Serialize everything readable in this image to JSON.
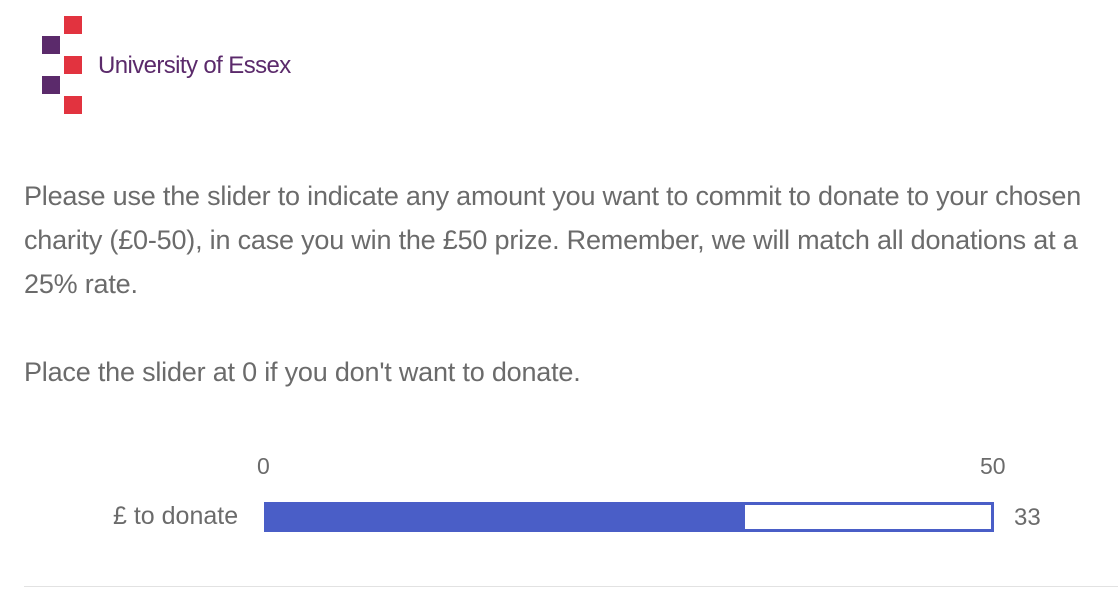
{
  "logo": {
    "text": "University of Essex",
    "colors": {
      "purple": "#5b2a6b",
      "red": "#e2333f"
    }
  },
  "question": {
    "paragraph1": "Please use the slider to indicate any amount you want to commit to donate to your chosen charity (£0-50), in case you win the £50 prize. Remember, we will match all donations at a 25% rate.",
    "paragraph2": "Place the slider at 0 if you don't want to donate."
  },
  "slider": {
    "label": "£ to donate",
    "min_label": "0",
    "max_label": "50",
    "min": 0,
    "max": 50,
    "value": 33,
    "value_display": "33",
    "accent_color": "#4a5ec7"
  }
}
